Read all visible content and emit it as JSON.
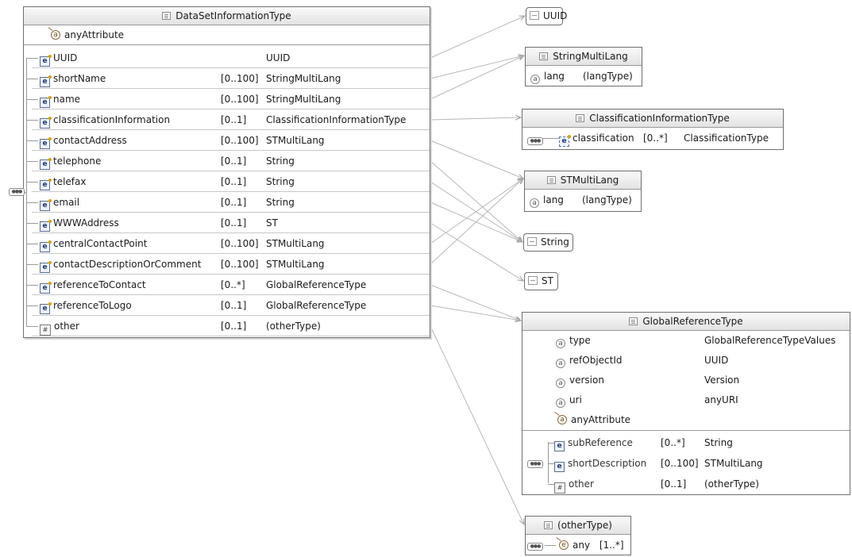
{
  "main": {
    "title": "DataSetInformationType",
    "any_attribute": "anyAttribute",
    "elements": [
      {
        "name": "UUID",
        "card": "",
        "type": "UUID"
      },
      {
        "name": "shortName",
        "card": "[0..100]",
        "type": "StringMultiLang"
      },
      {
        "name": "name",
        "card": "[0..100]",
        "type": "StringMultiLang"
      },
      {
        "name": "classificationInformation",
        "card": "[0..1]",
        "type": "ClassificationInformationType"
      },
      {
        "name": "contactAddress",
        "card": "[0..100]",
        "type": "STMultiLang"
      },
      {
        "name": "telephone",
        "card": "[0..1]",
        "type": "String"
      },
      {
        "name": "telefax",
        "card": "[0..1]",
        "type": "String"
      },
      {
        "name": "email",
        "card": "[0..1]",
        "type": "String"
      },
      {
        "name": "WWWAddress",
        "card": "[0..1]",
        "type": "ST"
      },
      {
        "name": "centralContactPoint",
        "card": "[0..100]",
        "type": "STMultiLang"
      },
      {
        "name": "contactDescriptionOrComment",
        "card": "[0..100]",
        "type": "STMultiLang"
      },
      {
        "name": "referenceToContact",
        "card": "[0..*]",
        "type": "GlobalReferenceType"
      },
      {
        "name": "referenceToLogo",
        "card": "[0..1]",
        "type": "GlobalReferenceType"
      },
      {
        "name": "other",
        "card": "[0..1]",
        "type": "(otherType)"
      }
    ]
  },
  "types": {
    "uuid": {
      "label": "UUID"
    },
    "string_multi_lang": {
      "title": "StringMultiLang",
      "attr_name": "lang",
      "attr_type": "(langType)"
    },
    "classification_information": {
      "title": "ClassificationInformationType",
      "el_name": "classification",
      "el_card": "[0..*]",
      "el_type": "ClassificationType"
    },
    "st_multi_lang": {
      "title": "STMultiLang",
      "attr_name": "lang",
      "attr_type": "(langType)"
    },
    "string": {
      "label": "String"
    },
    "st": {
      "label": "ST"
    },
    "global_reference": {
      "title": "GlobalReferenceType",
      "attributes": [
        {
          "name": "type",
          "type": "GlobalReferenceTypeValues"
        },
        {
          "name": "refObjectId",
          "type": "UUID"
        },
        {
          "name": "version",
          "type": "Version"
        },
        {
          "name": "uri",
          "type": "anyURI"
        }
      ],
      "any_attribute": "anyAttribute",
      "elements": [
        {
          "name": "subReference",
          "card": "[0..*]",
          "type": "String"
        },
        {
          "name": "shortDescription",
          "card": "[0..100]",
          "type": "STMultiLang"
        },
        {
          "name": "other",
          "card": "[0..1]",
          "type": "(otherType)"
        }
      ]
    },
    "other_type": {
      "title": "(otherType)",
      "el_name": "any",
      "el_card": "[1..*]"
    }
  },
  "connections": [
    {
      "from": "UUID",
      "to": "UUID"
    },
    {
      "from": "shortName",
      "to": "StringMultiLang"
    },
    {
      "from": "name",
      "to": "StringMultiLang"
    },
    {
      "from": "classificationInformation",
      "to": "ClassificationInformationType"
    },
    {
      "from": "contactAddress",
      "to": "STMultiLang"
    },
    {
      "from": "telephone",
      "to": "String"
    },
    {
      "from": "telefax",
      "to": "String"
    },
    {
      "from": "email",
      "to": "String"
    },
    {
      "from": "WWWAddress",
      "to": "ST"
    },
    {
      "from": "centralContactPoint",
      "to": "STMultiLang"
    },
    {
      "from": "contactDescriptionOrComment",
      "to": "STMultiLang"
    },
    {
      "from": "referenceToContact",
      "to": "GlobalReferenceType"
    },
    {
      "from": "referenceToLogo",
      "to": "GlobalReferenceType"
    },
    {
      "from": "other",
      "to": "(otherType)"
    }
  ],
  "colors": {
    "border": "#6f6f6f",
    "connector": "#b8b8b8",
    "header_bg": "#e6e6e6"
  }
}
